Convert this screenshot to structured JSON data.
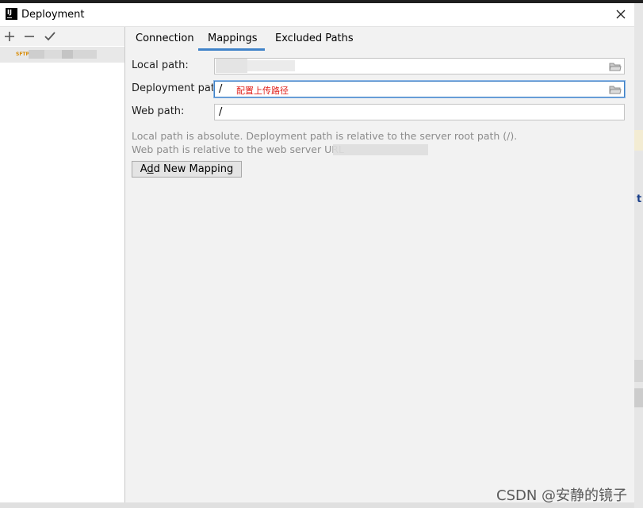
{
  "window": {
    "title": "Deployment",
    "app_icon_text": "IJ"
  },
  "left_pane": {
    "toolbar": {
      "add_icon": "plus-icon",
      "remove_icon": "minus-icon",
      "default_icon": "check-icon"
    },
    "server_item": {
      "protocol_label": "SFTP"
    }
  },
  "tabs": [
    {
      "label": "Connection",
      "active": false
    },
    {
      "label": "Mappings",
      "active": true
    },
    {
      "label": "Excluded Paths",
      "active": false
    }
  ],
  "form": {
    "local_path": {
      "label": "Local path:",
      "value": ""
    },
    "deployment_path": {
      "label": "Deployment path:",
      "value": "/",
      "annotation": "配置上传路径"
    },
    "web_path": {
      "label": "Web path:",
      "value": "/"
    }
  },
  "hints": {
    "line1": "Local path is absolute. Deployment path is relative to the server root path (/).",
    "line2": "Web path is relative to the web server URL"
  },
  "buttons": {
    "add_mapping_prefix": "A",
    "add_mapping_mnemonic": "d",
    "add_mapping_suffix": "d New Mapping"
  },
  "watermark": "CSDN @安静的镜子",
  "edge_fragment": "t",
  "colors": {
    "accent": "#4083c9",
    "annotation": "#e0201b",
    "focus_border": "#3d80c6"
  }
}
